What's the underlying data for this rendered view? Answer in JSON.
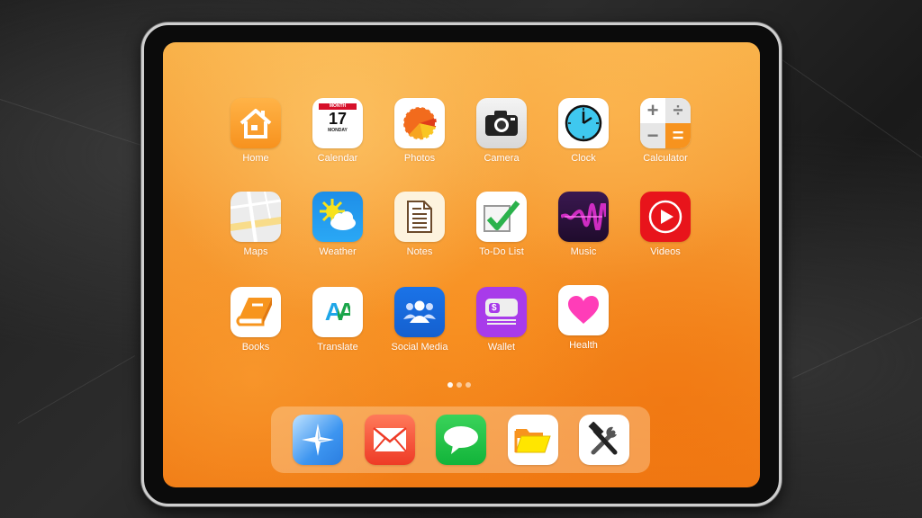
{
  "device": "tablet",
  "home_screen": {
    "rows": [
      [
        {
          "id": "home",
          "label": "Home",
          "icon": "house-icon"
        },
        {
          "id": "calendar",
          "label": "Calendar",
          "icon": "calendar-icon",
          "month": "MONTH",
          "day": "17",
          "weekday": "MONDAY"
        },
        {
          "id": "photos",
          "label": "Photos",
          "icon": "flower-icon"
        },
        {
          "id": "camera",
          "label": "Camera",
          "icon": "camera-icon"
        },
        {
          "id": "clock",
          "label": "Clock",
          "icon": "clock-icon"
        },
        {
          "id": "calculator",
          "label": "Calculator",
          "icon": "calculator-icon"
        }
      ],
      [
        {
          "id": "maps",
          "label": "Maps",
          "icon": "map-icon"
        },
        {
          "id": "weather",
          "label": "Weather",
          "icon": "sun-cloud-icon"
        },
        {
          "id": "notes",
          "label": "Notes",
          "icon": "document-icon"
        },
        {
          "id": "todo",
          "label": "To-Do List",
          "icon": "checkbox-icon"
        },
        {
          "id": "music",
          "label": "Music",
          "icon": "waveform-icon"
        },
        {
          "id": "videos",
          "label": "Videos",
          "icon": "play-icon"
        }
      ],
      [
        {
          "id": "books",
          "label": "Books",
          "icon": "book-icon"
        },
        {
          "id": "translate",
          "label": "Translate",
          "icon": "translate-icon",
          "glyph": "AA"
        },
        {
          "id": "social",
          "label": "Social Media",
          "icon": "people-icon"
        },
        {
          "id": "wallet",
          "label": "Wallet",
          "icon": "wallet-icon",
          "glyph": "$"
        },
        {
          "id": "health",
          "label": "Health",
          "icon": "heart-icon"
        }
      ]
    ],
    "page_indicator": {
      "pages": 3,
      "current": 1
    },
    "dock": [
      {
        "id": "compass",
        "icon": "compass-icon"
      },
      {
        "id": "mail",
        "icon": "mail-icon"
      },
      {
        "id": "messages",
        "icon": "chat-bubble-icon"
      },
      {
        "id": "files",
        "icon": "folder-icon"
      },
      {
        "id": "tools",
        "icon": "tools-icon"
      }
    ]
  }
}
